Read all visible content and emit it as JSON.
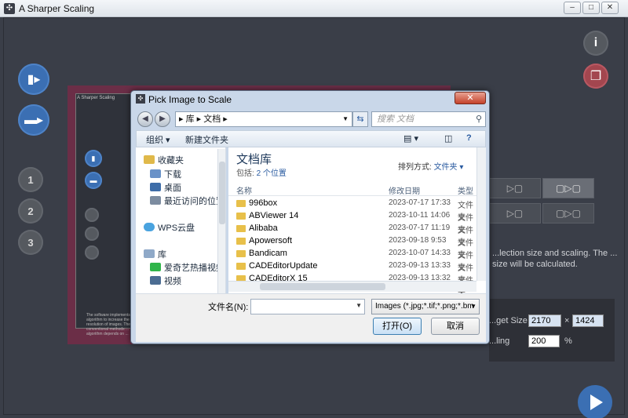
{
  "window": {
    "title": "A Sharper Scaling",
    "minimize": "–",
    "maximize": "□",
    "close": "✕"
  },
  "sidebar_left": {
    "mode1": "1",
    "mode2": "2",
    "mode3": "3"
  },
  "preview": {
    "mini_title": "A Sharper Scaling",
    "mini_text": "The software implements a new algorithm to increase the resolution of images. The conventional methods ... algorithm depends on ..."
  },
  "right_panel": {
    "hint": "...lection size and scaling. The ... size will be calculated.",
    "target_size_label": "...get Size",
    "width": "2170",
    "times": "×",
    "height": "1424",
    "scaling_label": "...ling",
    "scaling": "200",
    "percent": "%"
  },
  "dialog": {
    "title": "Pick Image to Scale",
    "close": "✕",
    "breadcrumb": "▸ 库 ▸ 文档 ▸",
    "search_placeholder": "搜索 文档",
    "toolbar": {
      "organize": "组织 ▾",
      "new_folder": "新建文件夹"
    },
    "nav": [
      {
        "label": "收藏夹",
        "color": "#e0b94a"
      },
      {
        "label": "下载",
        "color": "#6a92c8"
      },
      {
        "label": "桌面",
        "color": "#3e6da8"
      },
      {
        "label": "最近访问的位置",
        "color": "#7c8ca0"
      },
      {
        "label": "WPS云盘",
        "color": "#4aa3df"
      },
      {
        "label": "库",
        "color": "#8fa9c8"
      },
      {
        "label": "爱奇艺热播视频",
        "color": "#2fb54a"
      },
      {
        "label": "视频",
        "color": "#4b6c92"
      }
    ],
    "library": {
      "title": "文档库",
      "subtitle_prefix": "包括: ",
      "subtitle_link": "2 个位置",
      "arrange_label": "排列方式: ",
      "arrange_value": "文件夹 ▾"
    },
    "columns": {
      "name": "名称",
      "date": "修改日期",
      "type": "类型"
    },
    "files": [
      {
        "name": "996box",
        "date": "2023-07-17 17:33",
        "type": "文件夹"
      },
      {
        "name": "ABViewer 14",
        "date": "2023-10-11 14:06",
        "type": "文件夹"
      },
      {
        "name": "Alibaba",
        "date": "2023-07-17 11:19",
        "type": "文件夹"
      },
      {
        "name": "Apowersoft",
        "date": "2023-09-18 9:53",
        "type": "文件夹"
      },
      {
        "name": "Bandicam",
        "date": "2023-10-07 14:33",
        "type": "文件夹"
      },
      {
        "name": "CADEditorUpdate",
        "date": "2023-09-13 13:33",
        "type": "文件夹"
      },
      {
        "name": "CADEditorX 15",
        "date": "2023-09-13 13:32",
        "type": "文件夹"
      }
    ],
    "filename_label": "文件名(N):",
    "filter": "Images (*.jpg;*.tif;*.png;*.bm",
    "open": "打开(O)",
    "cancel": "取消"
  }
}
